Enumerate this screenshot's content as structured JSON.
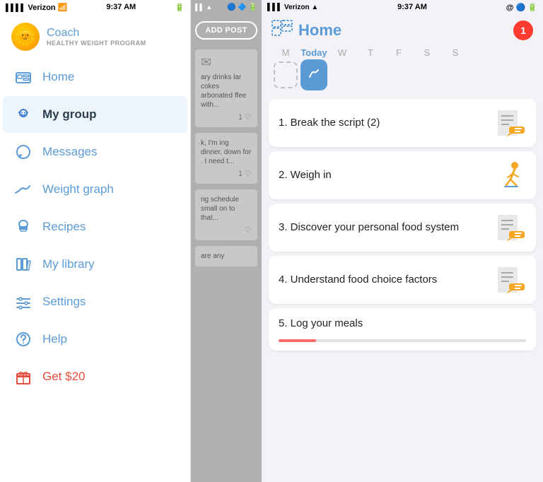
{
  "app": {
    "title": "Home"
  },
  "left_panel": {
    "status": {
      "carrier": "Verizon",
      "time": "9:37 AM",
      "wifi": true,
      "battery": "full"
    },
    "coach": {
      "name": "Coach",
      "subtitle": "HEALTHY WEIGHT PROGRAM",
      "avatar_emoji": "🌞"
    },
    "nav_items": [
      {
        "id": "home",
        "label": "Home",
        "icon": "home"
      },
      {
        "id": "my-group",
        "label": "My group",
        "icon": "group",
        "active": true
      },
      {
        "id": "messages",
        "label": "Messages",
        "icon": "message"
      },
      {
        "id": "weight-graph",
        "label": "Weight graph",
        "icon": "graph"
      },
      {
        "id": "recipes",
        "label": "Recipes",
        "icon": "chef"
      },
      {
        "id": "my-library",
        "label": "My library",
        "icon": "library"
      },
      {
        "id": "settings",
        "label": "Settings",
        "icon": "settings"
      },
      {
        "id": "help",
        "label": "Help",
        "icon": "help"
      },
      {
        "id": "get20",
        "label": "Get $20",
        "icon": "gift"
      }
    ]
  },
  "middle_panel": {
    "add_post_label": "ADD POST",
    "posts": [
      {
        "text": "ary drinks lar cokes arbonated ffee with...",
        "likes": "1 ♡"
      },
      {
        "text": "k, I'm ing dinner, down for . I need t...",
        "likes": "1 ♡"
      },
      {
        "text": "ng schedule small on to that...",
        "likes": "♡"
      },
      {
        "text": "are any",
        "likes": ""
      }
    ]
  },
  "right_panel": {
    "status": {
      "carrier": "Verizon",
      "time": "9:37 AM"
    },
    "title": "Home",
    "notification_count": "1",
    "days": [
      {
        "label": "M",
        "active": false,
        "dashed": false
      },
      {
        "label": "Today",
        "active": true,
        "dashed": false
      },
      {
        "label": "W",
        "active": false,
        "dashed": false
      },
      {
        "label": "T",
        "active": false,
        "dashed": false
      },
      {
        "label": "F",
        "active": false,
        "dashed": false
      },
      {
        "label": "S",
        "active": false,
        "dashed": false
      },
      {
        "label": "S",
        "active": false,
        "dashed": false
      }
    ],
    "tasks": [
      {
        "number": "1",
        "title": "Break the script (2)",
        "icon": "note"
      },
      {
        "number": "2",
        "title": "Weigh in",
        "icon": "walker"
      },
      {
        "number": "3",
        "title": "Discover your personal food system",
        "icon": "note"
      },
      {
        "number": "4",
        "title": "Understand food choice factors",
        "icon": "note"
      },
      {
        "number": "5",
        "title": "Log your meals",
        "icon": "progress"
      }
    ]
  }
}
